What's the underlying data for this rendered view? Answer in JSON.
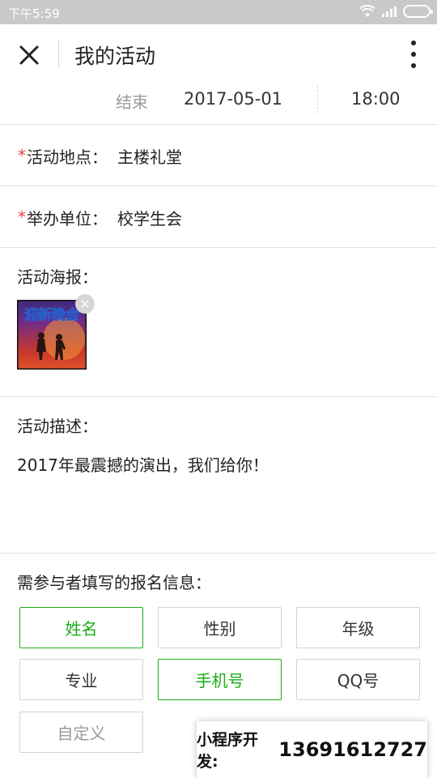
{
  "status_bar": {
    "time": "下午5:59"
  },
  "navbar": {
    "title": "我的活动"
  },
  "end_row": {
    "label": "结束",
    "date": "2017-05-01",
    "time": "18:00"
  },
  "location": {
    "required_mark": "*",
    "label": "活动地点：",
    "value": "主楼礼堂"
  },
  "organizer": {
    "required_mark": "*",
    "label": "举办单位：",
    "value": "校学生会"
  },
  "poster": {
    "label": "活动海报：",
    "image_text": "迎新晚会",
    "delete_glyph": "×"
  },
  "description": {
    "label": "活动描述：",
    "text": "2017年最震撼的演出，我们给你！"
  },
  "registration": {
    "label": "需参与者填写的报名信息：",
    "accent_color": "#1aad19",
    "options": [
      {
        "label": "姓名",
        "selected": true
      },
      {
        "label": "性别",
        "selected": false
      },
      {
        "label": "年级",
        "selected": false
      },
      {
        "label": "专业",
        "selected": false
      },
      {
        "label": "手机号",
        "selected": true
      },
      {
        "label": "QQ号",
        "selected": false
      },
      {
        "label": "自定义",
        "selected": false
      }
    ]
  },
  "promo": {
    "label": "小程序开发:",
    "phone": "13691612727"
  }
}
